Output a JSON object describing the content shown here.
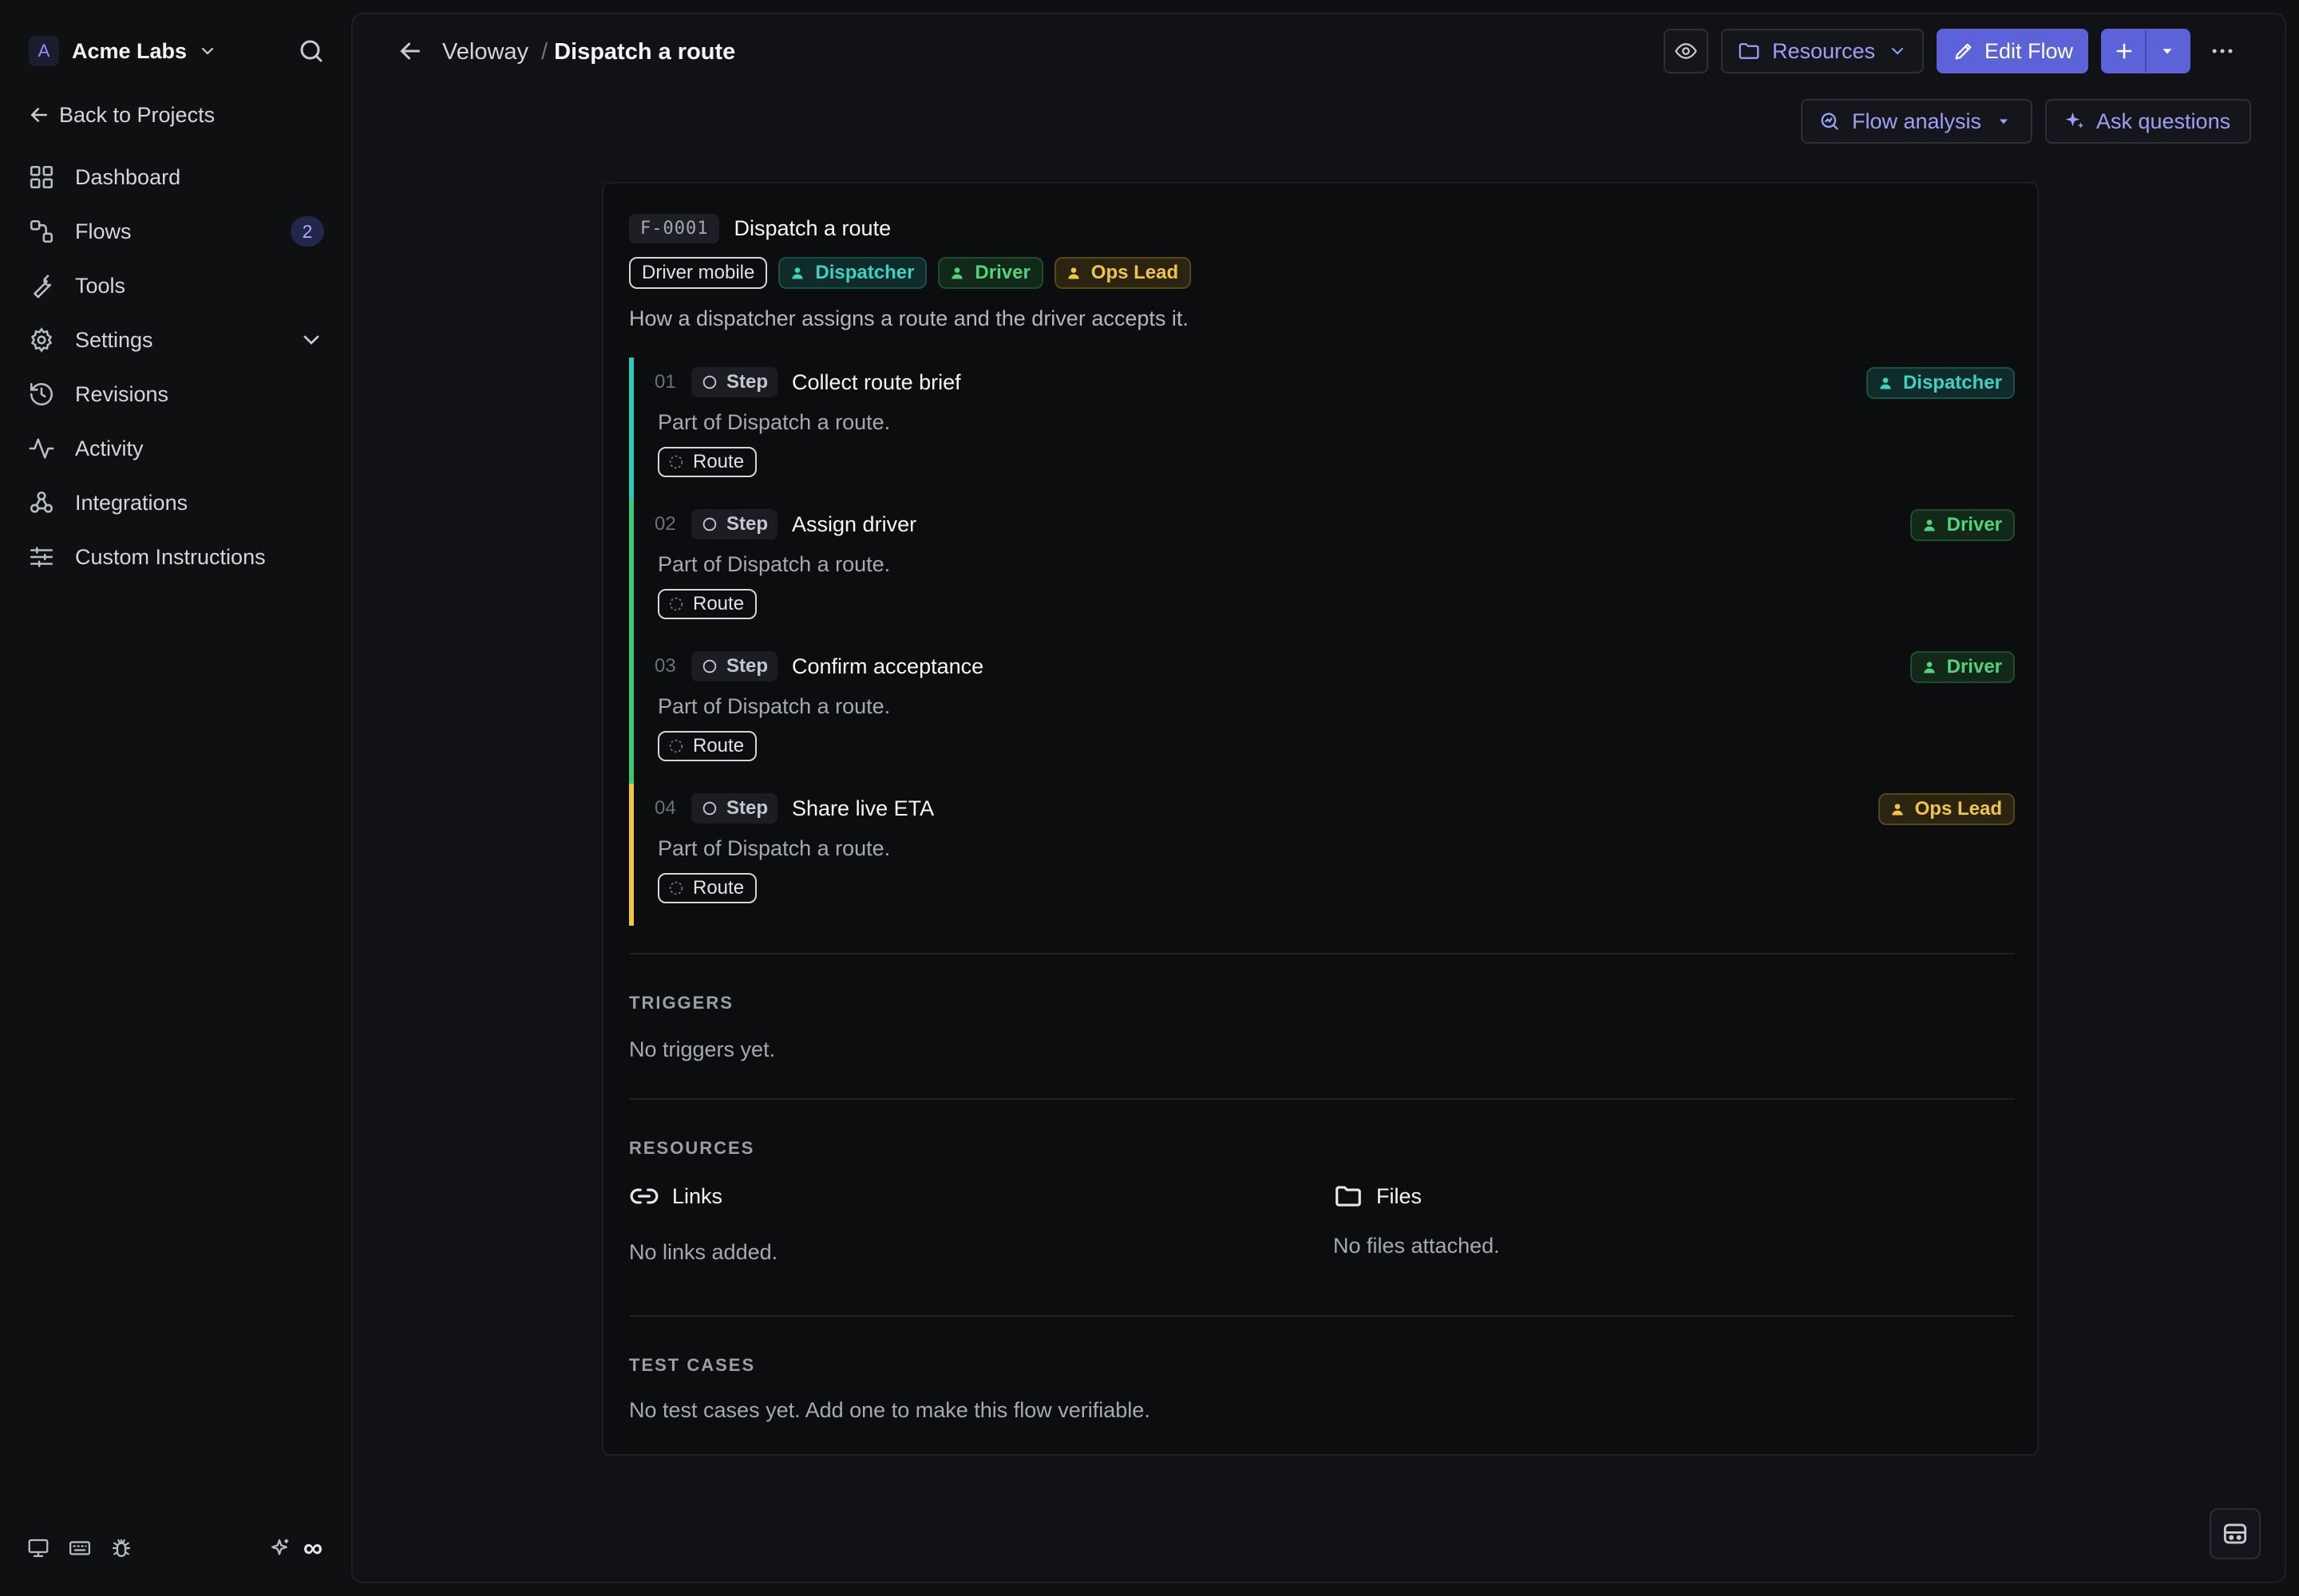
{
  "workspace": {
    "initial": "A",
    "name": "Acme Labs"
  },
  "sidebar": {
    "back_label": "Back to Projects",
    "items": [
      {
        "label": "Dashboard",
        "icon": "grid-icon"
      },
      {
        "label": "Flows",
        "icon": "flows-icon",
        "badge": "2"
      },
      {
        "label": "Tools",
        "icon": "wrench-icon"
      },
      {
        "label": "Settings",
        "icon": "gear-icon"
      },
      {
        "label": "Revisions",
        "icon": "history-icon"
      },
      {
        "label": "Activity",
        "icon": "activity-icon"
      },
      {
        "label": "Integrations",
        "icon": "webhook-icon"
      },
      {
        "label": "Custom Instructions",
        "icon": "sliders-icon"
      }
    ],
    "footer_infinity": "∞"
  },
  "header": {
    "project": "Veloway",
    "separator": "/",
    "page": "Dispatch a route",
    "resources_label": "Resources",
    "edit_label": "Edit Flow",
    "flow_analysis_label": "Flow analysis",
    "ask_label": "Ask questions"
  },
  "flow": {
    "id": "F-0001",
    "title": "Dispatch a route",
    "platform_tag": "Driver mobile",
    "roles": [
      "Dispatcher",
      "Driver",
      "Ops Lead"
    ],
    "description": "How a dispatcher assigns a route and the driver accepts it.",
    "step_pill_label": "Step",
    "steps": [
      {
        "num": "01",
        "name": "Collect route brief",
        "desc": "Part of Dispatch a route.",
        "tag": "Route",
        "role": "Dispatcher"
      },
      {
        "num": "02",
        "name": "Assign driver",
        "desc": "Part of Dispatch a route.",
        "tag": "Route",
        "role": "Driver"
      },
      {
        "num": "03",
        "name": "Confirm acceptance",
        "desc": "Part of Dispatch a route.",
        "tag": "Route",
        "role": "Driver"
      },
      {
        "num": "04",
        "name": "Share live ETA",
        "desc": "Part of Dispatch a route.",
        "tag": "Route",
        "role": "Ops Lead"
      }
    ]
  },
  "triggers": {
    "label": "TRIGGERS",
    "empty": "No triggers yet."
  },
  "resources": {
    "label": "RESOURCES",
    "links_title": "Links",
    "links_empty": "No links added.",
    "files_title": "Files",
    "files_empty": "No files attached."
  },
  "tests": {
    "label": "TEST CASES",
    "empty": "No test cases yet. Add one to make this flow verifiable."
  },
  "colors": {
    "accent": "#5c62d8",
    "dispatcher": "#3fd1c0",
    "driver": "#51d37a",
    "ops_lead": "#f2c34a"
  }
}
